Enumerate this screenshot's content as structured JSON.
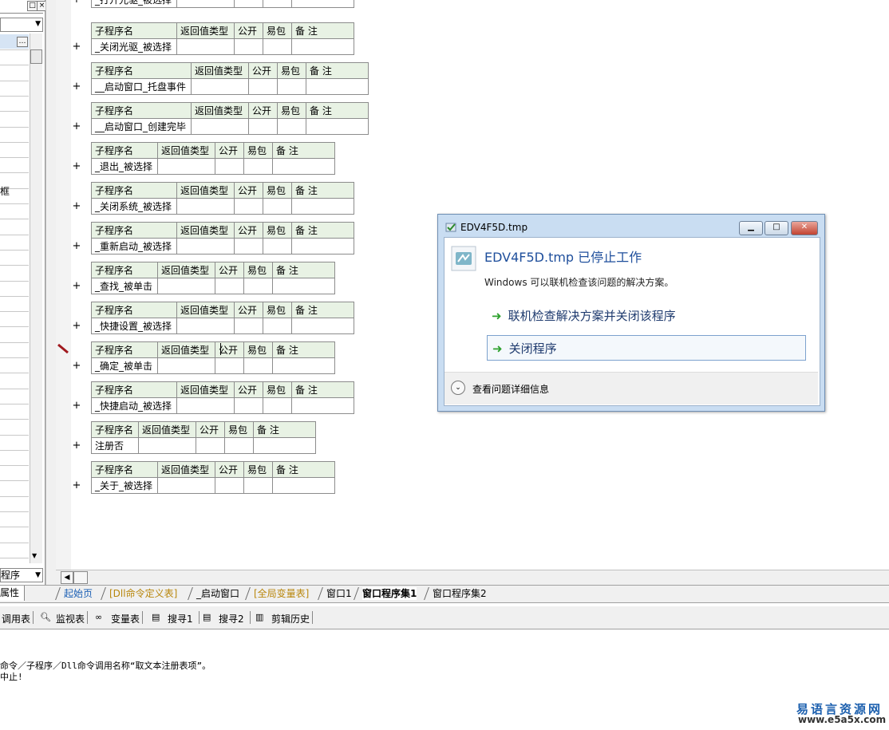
{
  "left_panel": {
    "visible_fragment": "框",
    "dropdown_value": "程序",
    "tab_label": "属性"
  },
  "headers": [
    "子程序名",
    "返回值类型",
    "公开",
    "易包",
    "备 注"
  ],
  "subroutines": [
    {
      "name": "_打开光驱_被选择",
      "partial": true
    },
    {
      "name": "_关闭光驱_被选择"
    },
    {
      "name": "__启动窗口_托盘事件"
    },
    {
      "name": "__启动窗口_创建完毕"
    },
    {
      "name": "_退出_被选择"
    },
    {
      "name": "_关闭系统_被选择"
    },
    {
      "name": "_重新启动_被选择"
    },
    {
      "name": "_查找_被单击"
    },
    {
      "name": "_快捷设置_被选择"
    },
    {
      "name": "_确定_被单击"
    },
    {
      "name": "_快捷启动_被选择"
    },
    {
      "name": "注册否"
    },
    {
      "name": "_关于_被选择"
    }
  ],
  "plus_symbol": "+",
  "tabs": [
    {
      "label": "起始页",
      "color": "#1a5fb4"
    },
    {
      "label": "[Dll命令定义表]",
      "color": "#b8860b"
    },
    {
      "label": "_启动窗口",
      "color": "#000000"
    },
    {
      "label": "[全局变量表]",
      "color": "#b8860b"
    },
    {
      "label": "窗口1",
      "color": "#000000"
    },
    {
      "label": "窗口程序集1",
      "color": "#000000",
      "active": true
    },
    {
      "label": "窗口程序集2",
      "color": "#000000"
    }
  ],
  "toolbar": [
    "调用表",
    "监视表",
    "变量表",
    "搜寻1",
    "搜寻2",
    "剪辑历史"
  ],
  "output": {
    "line1": "命令／子程序／Dll命令调用名称“取文本注册表项”。",
    "line2": "中止!"
  },
  "dialog": {
    "title": "EDV4F5D.tmp",
    "heading": "EDV4F5D.tmp 已停止工作",
    "message": "Windows 可以联机检查该问题的解决方案。",
    "option1": "联机检查解决方案并关闭该程序",
    "option2": "关闭程序",
    "details": "查看问题详细信息",
    "heading_color": "#1f4f9c"
  },
  "watermark": {
    "line1": "易语言资源网",
    "line2": "www.e5a5x.com"
  }
}
